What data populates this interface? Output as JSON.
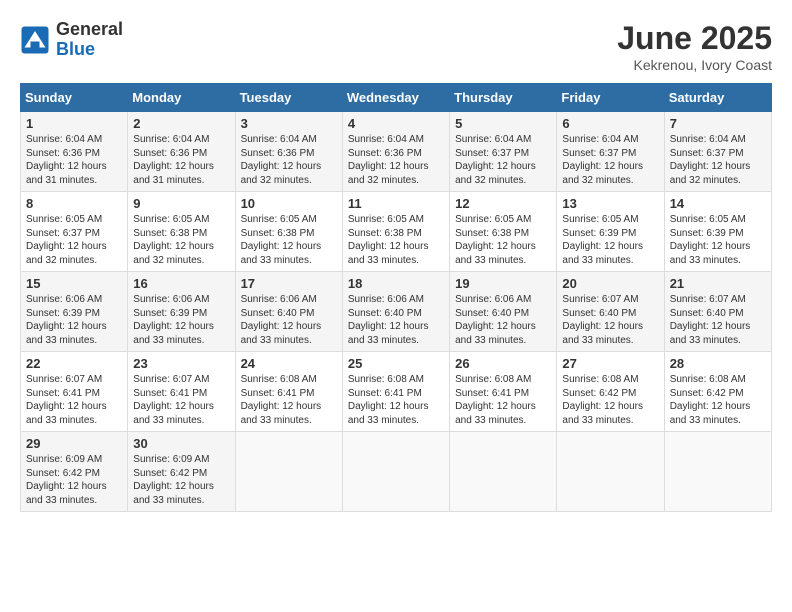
{
  "logo": {
    "general": "General",
    "blue": "Blue"
  },
  "title": "June 2025",
  "subtitle": "Kekrenou, Ivory Coast",
  "days_header": [
    "Sunday",
    "Monday",
    "Tuesday",
    "Wednesday",
    "Thursday",
    "Friday",
    "Saturday"
  ],
  "weeks": [
    [
      {
        "day": "1",
        "info": "Sunrise: 6:04 AM\nSunset: 6:36 PM\nDaylight: 12 hours\nand 31 minutes."
      },
      {
        "day": "2",
        "info": "Sunrise: 6:04 AM\nSunset: 6:36 PM\nDaylight: 12 hours\nand 31 minutes."
      },
      {
        "day": "3",
        "info": "Sunrise: 6:04 AM\nSunset: 6:36 PM\nDaylight: 12 hours\nand 32 minutes."
      },
      {
        "day": "4",
        "info": "Sunrise: 6:04 AM\nSunset: 6:36 PM\nDaylight: 12 hours\nand 32 minutes."
      },
      {
        "day": "5",
        "info": "Sunrise: 6:04 AM\nSunset: 6:37 PM\nDaylight: 12 hours\nand 32 minutes."
      },
      {
        "day": "6",
        "info": "Sunrise: 6:04 AM\nSunset: 6:37 PM\nDaylight: 12 hours\nand 32 minutes."
      },
      {
        "day": "7",
        "info": "Sunrise: 6:04 AM\nSunset: 6:37 PM\nDaylight: 12 hours\nand 32 minutes."
      }
    ],
    [
      {
        "day": "8",
        "info": "Sunrise: 6:05 AM\nSunset: 6:37 PM\nDaylight: 12 hours\nand 32 minutes."
      },
      {
        "day": "9",
        "info": "Sunrise: 6:05 AM\nSunset: 6:38 PM\nDaylight: 12 hours\nand 32 minutes."
      },
      {
        "day": "10",
        "info": "Sunrise: 6:05 AM\nSunset: 6:38 PM\nDaylight: 12 hours\nand 33 minutes."
      },
      {
        "day": "11",
        "info": "Sunrise: 6:05 AM\nSunset: 6:38 PM\nDaylight: 12 hours\nand 33 minutes."
      },
      {
        "day": "12",
        "info": "Sunrise: 6:05 AM\nSunset: 6:38 PM\nDaylight: 12 hours\nand 33 minutes."
      },
      {
        "day": "13",
        "info": "Sunrise: 6:05 AM\nSunset: 6:39 PM\nDaylight: 12 hours\nand 33 minutes."
      },
      {
        "day": "14",
        "info": "Sunrise: 6:05 AM\nSunset: 6:39 PM\nDaylight: 12 hours\nand 33 minutes."
      }
    ],
    [
      {
        "day": "15",
        "info": "Sunrise: 6:06 AM\nSunset: 6:39 PM\nDaylight: 12 hours\nand 33 minutes."
      },
      {
        "day": "16",
        "info": "Sunrise: 6:06 AM\nSunset: 6:39 PM\nDaylight: 12 hours\nand 33 minutes."
      },
      {
        "day": "17",
        "info": "Sunrise: 6:06 AM\nSunset: 6:40 PM\nDaylight: 12 hours\nand 33 minutes."
      },
      {
        "day": "18",
        "info": "Sunrise: 6:06 AM\nSunset: 6:40 PM\nDaylight: 12 hours\nand 33 minutes."
      },
      {
        "day": "19",
        "info": "Sunrise: 6:06 AM\nSunset: 6:40 PM\nDaylight: 12 hours\nand 33 minutes."
      },
      {
        "day": "20",
        "info": "Sunrise: 6:07 AM\nSunset: 6:40 PM\nDaylight: 12 hours\nand 33 minutes."
      },
      {
        "day": "21",
        "info": "Sunrise: 6:07 AM\nSunset: 6:40 PM\nDaylight: 12 hours\nand 33 minutes."
      }
    ],
    [
      {
        "day": "22",
        "info": "Sunrise: 6:07 AM\nSunset: 6:41 PM\nDaylight: 12 hours\nand 33 minutes."
      },
      {
        "day": "23",
        "info": "Sunrise: 6:07 AM\nSunset: 6:41 PM\nDaylight: 12 hours\nand 33 minutes."
      },
      {
        "day": "24",
        "info": "Sunrise: 6:08 AM\nSunset: 6:41 PM\nDaylight: 12 hours\nand 33 minutes."
      },
      {
        "day": "25",
        "info": "Sunrise: 6:08 AM\nSunset: 6:41 PM\nDaylight: 12 hours\nand 33 minutes."
      },
      {
        "day": "26",
        "info": "Sunrise: 6:08 AM\nSunset: 6:41 PM\nDaylight: 12 hours\nand 33 minutes."
      },
      {
        "day": "27",
        "info": "Sunrise: 6:08 AM\nSunset: 6:42 PM\nDaylight: 12 hours\nand 33 minutes."
      },
      {
        "day": "28",
        "info": "Sunrise: 6:08 AM\nSunset: 6:42 PM\nDaylight: 12 hours\nand 33 minutes."
      }
    ],
    [
      {
        "day": "29",
        "info": "Sunrise: 6:09 AM\nSunset: 6:42 PM\nDaylight: 12 hours\nand 33 minutes."
      },
      {
        "day": "30",
        "info": "Sunrise: 6:09 AM\nSunset: 6:42 PM\nDaylight: 12 hours\nand 33 minutes."
      },
      null,
      null,
      null,
      null,
      null
    ]
  ]
}
